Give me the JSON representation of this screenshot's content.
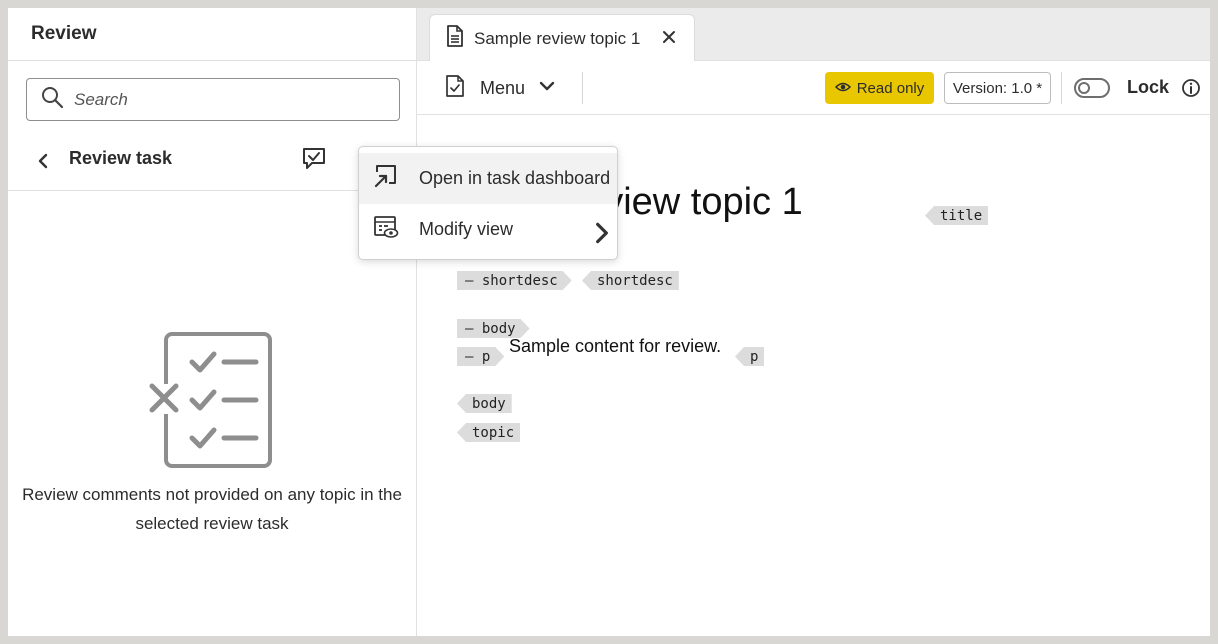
{
  "left_panel": {
    "title": "Review",
    "search": {
      "placeholder": "Search",
      "value": ""
    },
    "task_label": "Review task",
    "empty_message": "Review comments not provided on any topic in the selected review task"
  },
  "context_menu": {
    "items": [
      {
        "label": "Open in task dashboard",
        "icon": "open-in-dashboard-icon",
        "highlighted": true
      },
      {
        "label": "Modify view",
        "icon": "modify-view-icon",
        "has_submenu": true
      }
    ]
  },
  "tab": {
    "label": "Sample review topic 1",
    "icon": "document-icon"
  },
  "toolbar": {
    "menu_label": "Menu",
    "readonly_label": "Read only",
    "version_label": "Version: 1.0 *",
    "lock_label": "Lock",
    "lock_on": false,
    "accent_color": "#e8c600"
  },
  "editor": {
    "title_text": "Sample review topic 1",
    "title_tag": "title",
    "shortdesc_open": "shortdesc",
    "shortdesc_close": "shortdesc",
    "body_open": "body",
    "p_open": "p",
    "paragraph": "Sample content for review.",
    "p_close": "p",
    "body_close": "body",
    "topic_close": "topic",
    "collapse_glyph": "—"
  }
}
